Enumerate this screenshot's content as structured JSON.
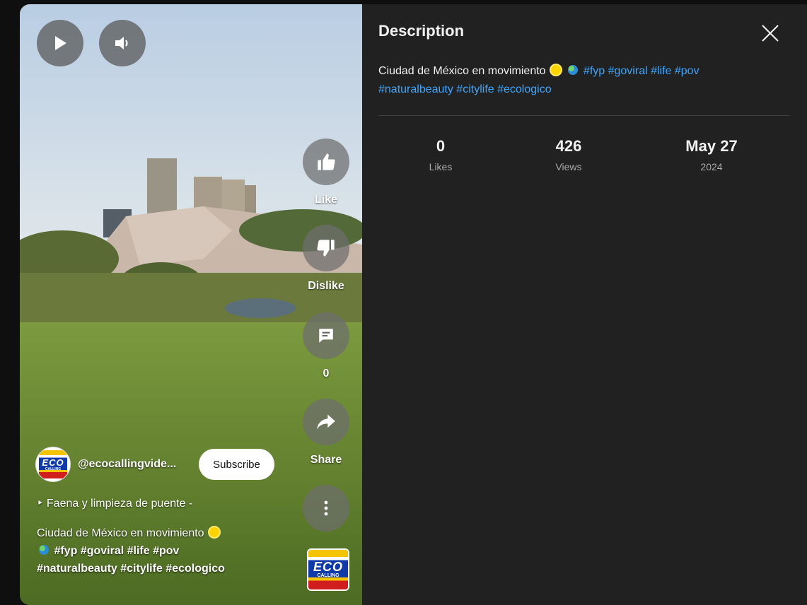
{
  "player": {
    "play_icon": "play-icon",
    "volume_icon": "volume-icon"
  },
  "actions": {
    "like_label": "Like",
    "dislike_label": "Dislike",
    "comments_count": "0",
    "share_label": "Share",
    "more_icon": "more-vert-icon"
  },
  "overlay": {
    "channel_handle": "@ecocallingvide...",
    "subscribe_label": "Subscribe",
    "music_bullet": "‣",
    "music_text": "Faena y limpieza de puente -",
    "caption_text": "Ciudad de México en movimiento",
    "caption_tags_line1": "#fyp #goviral #life #pov",
    "caption_tags_line2": "#naturalbeauty #citylife #ecologico",
    "logo_word": "ECO",
    "logo_subword": "CALLING"
  },
  "panel": {
    "title": "Description",
    "close_icon": "close-icon",
    "description_text": "Ciudad de México en movimiento",
    "hashtags_line1": "#fyp #goviral #life #pov",
    "hashtags_line2": "#naturalbeauty #citylife #ecologico",
    "stats": [
      {
        "value": "0",
        "label": "Likes"
      },
      {
        "value": "426",
        "label": "Views"
      },
      {
        "value": "May 27",
        "label": "2024"
      }
    ]
  },
  "colors": {
    "panel_bg": "#212121",
    "hashtag_link": "#3ea6ff",
    "stat_label": "#aaaaaa"
  }
}
